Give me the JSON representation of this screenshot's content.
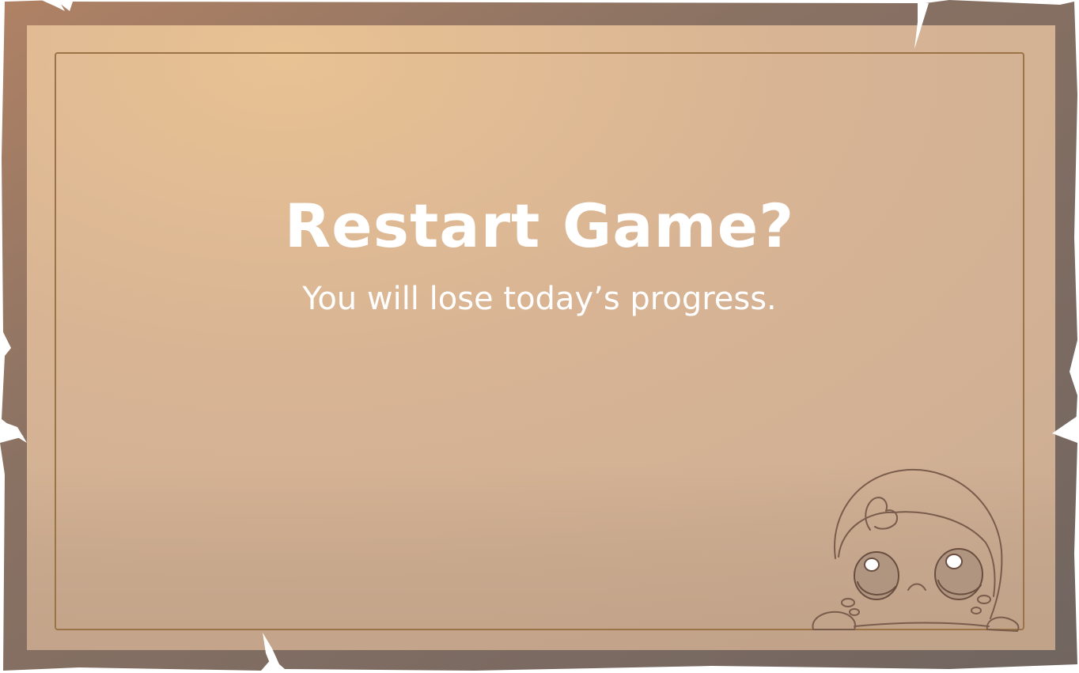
{
  "dialog": {
    "title": "Restart Game?",
    "message": "You will lose today’s progress."
  },
  "colors": {
    "parchment_light": "#e6bf94",
    "parchment_mid": "#d6b193",
    "parchment_dark": "#c9ab92",
    "frame_outer": "#7b6a61",
    "frame_inner": "#9b846f",
    "inner_rule": "#9a7346",
    "text": "#ffffff"
  },
  "mascot": {
    "icon": "peeking-sad-creature-icon"
  }
}
